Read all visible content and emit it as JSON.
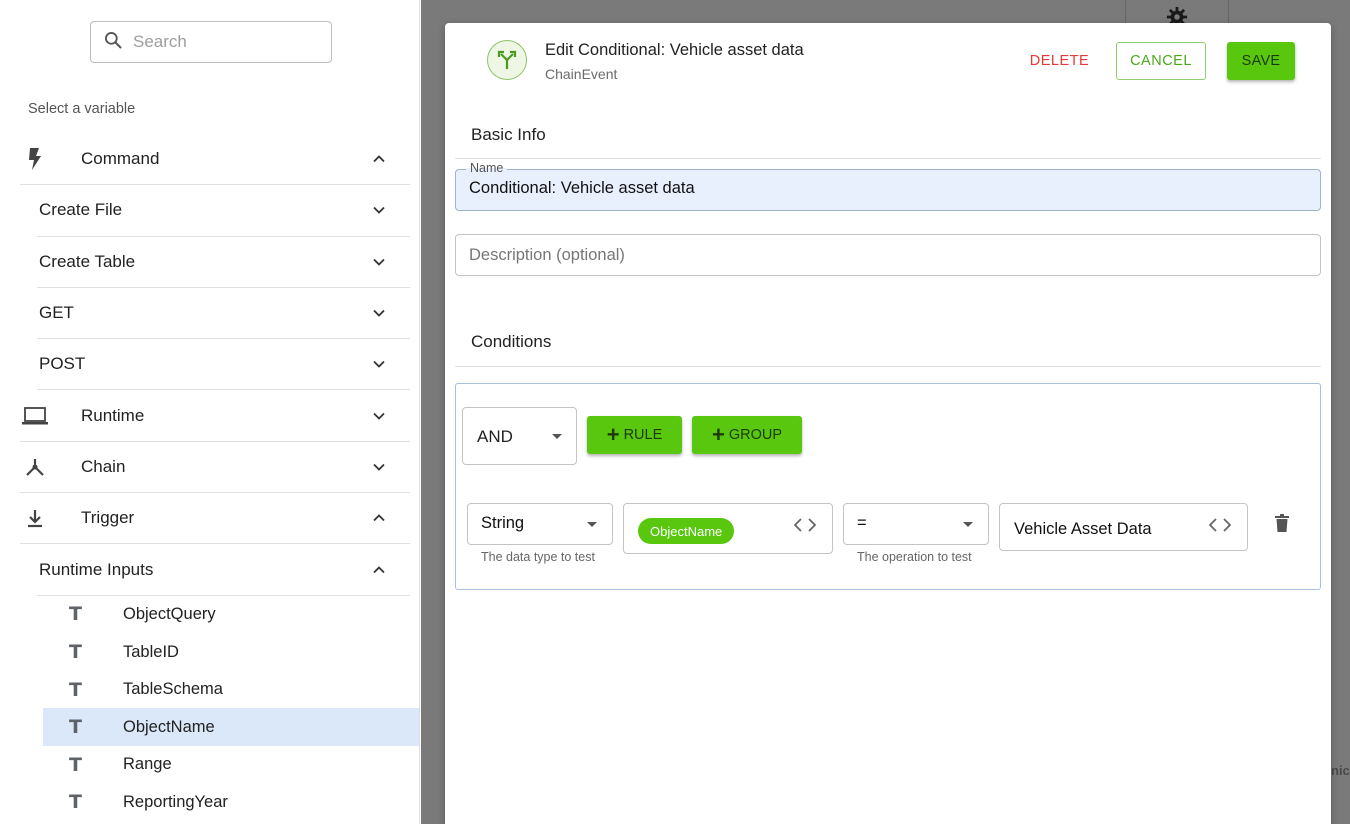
{
  "sidebar": {
    "search": {
      "placeholder": "Search"
    },
    "select_label": "Select a variable",
    "categories": [
      {
        "label": "Command",
        "icon": "lightning-icon",
        "expanded": true
      },
      {
        "label": "Runtime",
        "icon": "laptop-icon",
        "expanded": false
      },
      {
        "label": "Chain",
        "icon": "chain-fork-icon",
        "expanded": false
      },
      {
        "label": "Trigger",
        "icon": "trigger-download-icon",
        "expanded": true
      }
    ],
    "command_items": [
      "Create File",
      "Create Table",
      "GET",
      "POST"
    ],
    "trigger_items": [
      {
        "label": "Runtime Inputs",
        "expanded": true
      }
    ],
    "runtime_inputs": [
      "ObjectQuery",
      "TableID",
      "TableSchema",
      "ObjectName",
      "Range",
      "ReportingYear"
    ],
    "selected_input": "ObjectName",
    "text_type_glyph": "T"
  },
  "background": {
    "partial_text": "nic"
  },
  "modal": {
    "title": "Edit Conditional: Vehicle asset data",
    "subtitle": "ChainEvent",
    "delete_label": "DELETE",
    "cancel_label": "CANCEL",
    "save_label": "SAVE",
    "basic_info_title": "Basic Info",
    "name_label": "Name",
    "name_value": "Conditional: Vehicle asset data",
    "description_placeholder": "Description (optional)",
    "conditions_title": "Conditions",
    "combinator": "AND",
    "add_rule_label": "RULE",
    "add_group_label": "GROUP",
    "rule": {
      "data_type": "String",
      "data_type_helper": "The data type to test",
      "variable_chip": "ObjectName",
      "operator": "=",
      "operator_helper": "The operation to test",
      "value": "Vehicle Asset Data"
    }
  },
  "colors": {
    "accent_green": "#58c70e",
    "delete_red": "#e53935",
    "selected_row": "#dbe8f9",
    "name_field_bg": "#e8f0fe"
  }
}
